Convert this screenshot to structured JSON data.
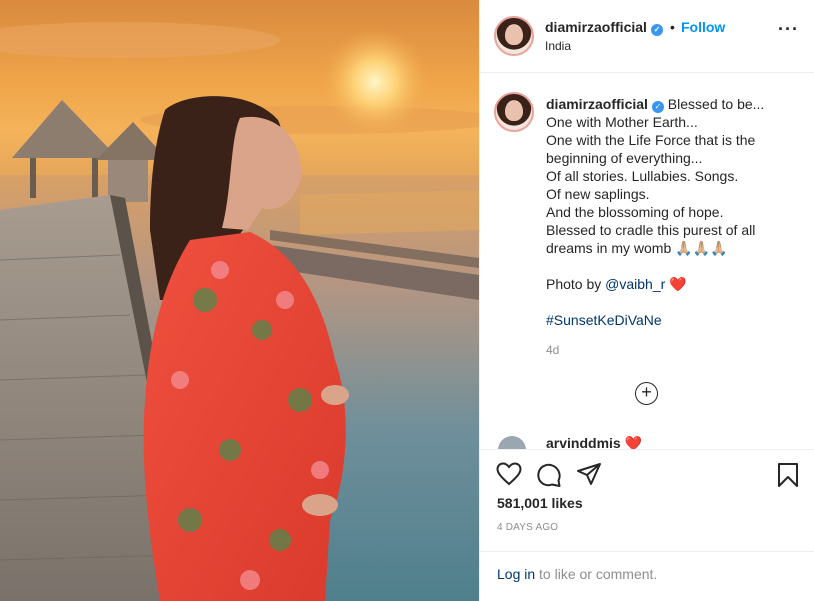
{
  "post": {
    "username": "diamirzaofficial",
    "verified_icon": "verified-badge-icon",
    "separator": "•",
    "follow_label": "Follow",
    "location": "India",
    "more_icon": "more-options-icon"
  },
  "caption": {
    "username": "diamirzaofficial",
    "text_part1": " Blessed to be...\nOne with Mother Earth...\nOne with the Life Force that is the beginning of everything...\nOf all stories. Lullabies. Songs.\nOf new saplings.\nAnd the blossoming of hope.\nBlessed to cradle this purest of all dreams in my womb 🙏🏼🙏🏼🙏🏼\n\nPhoto by ",
    "mention": "@vaibh_r",
    "heart": " ❤️",
    "hashtag": "#SunsetKeDiVaNe",
    "time_ago": "4d",
    "load_more_icon": "plus-circle-icon"
  },
  "comment_peek": {
    "text": "arvinddmis ❤️"
  },
  "actions": {
    "like_icon": "heart-icon",
    "comment_icon": "comment-icon",
    "share_icon": "paper-plane-icon",
    "save_icon": "bookmark-icon",
    "likes": "581,001 likes",
    "date": "4 DAYS AGO"
  },
  "login": {
    "link": "Log in",
    "rest": " to like or comment."
  },
  "colors": {
    "accent": "#0095f6",
    "link_dark": "#00376b",
    "muted": "#8e8e8e",
    "border": "#efefef"
  }
}
